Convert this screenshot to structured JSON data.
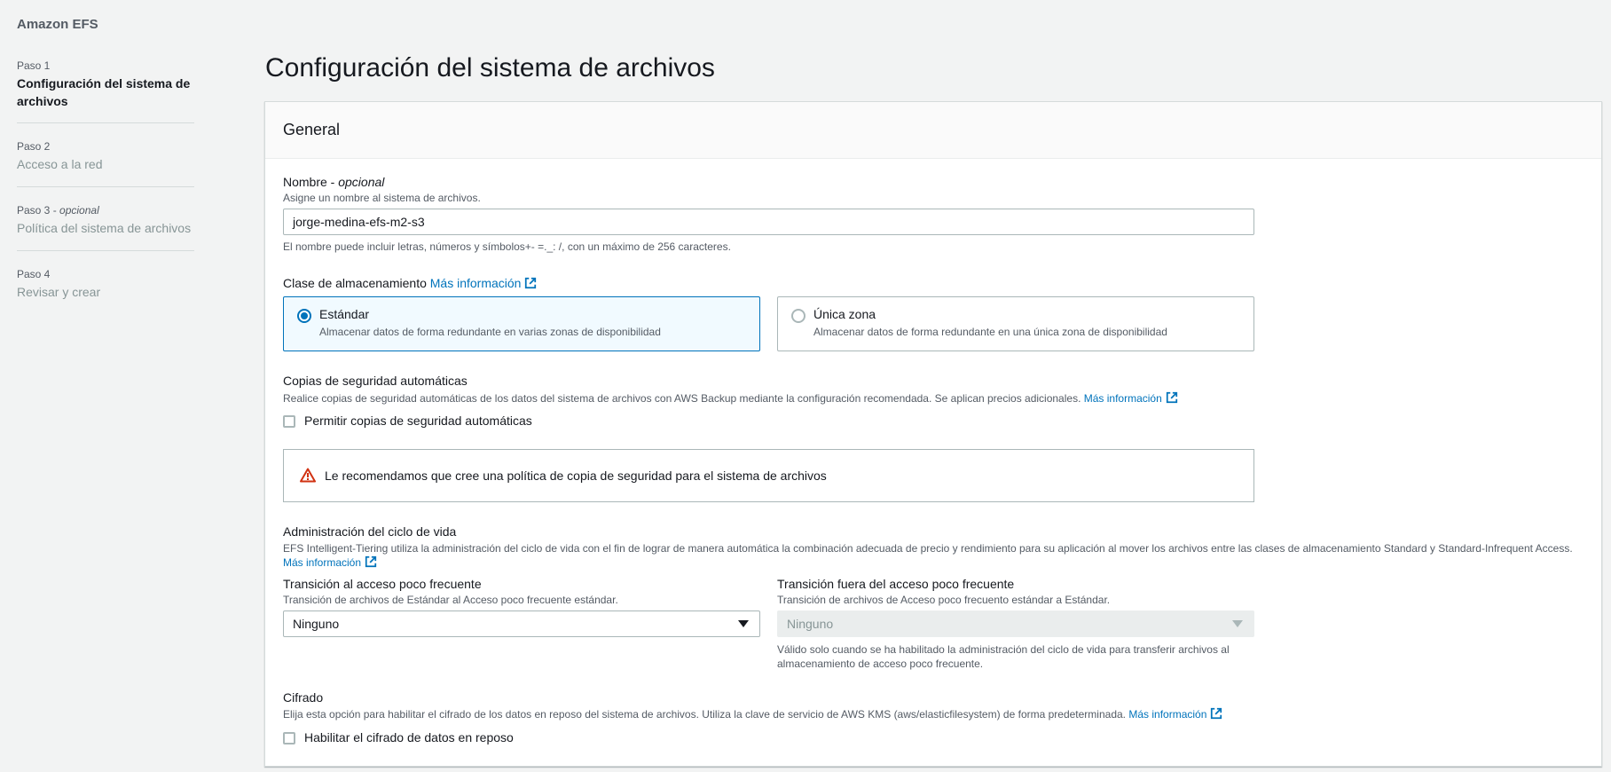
{
  "app": {
    "service_name": "Amazon EFS"
  },
  "steps": [
    {
      "num": "Paso 1",
      "optional": "",
      "title": "Configuración del sistema de archivos",
      "active": true
    },
    {
      "num": "Paso 2",
      "optional": "",
      "title": "Acceso a la red",
      "active": false
    },
    {
      "num": "Paso 3",
      "optional": "opcional",
      "title": "Política del sistema de archivos",
      "active": false
    },
    {
      "num": "Paso 4",
      "optional": "",
      "title": "Revisar y crear",
      "active": false
    }
  ],
  "page": {
    "title": "Configuración del sistema de archivos"
  },
  "panel": {
    "header": "General"
  },
  "name_field": {
    "label": "Nombre - ",
    "optional": "opcional",
    "description": "Asigne un nombre al sistema de archivos.",
    "value": "jorge-medina-efs-m2-s3",
    "constraint": "El nombre puede incluir letras, números y símbolos+- =._: /, con un máximo de 256 caracteres."
  },
  "storage_class": {
    "label": "Clase de almacenamiento",
    "info_link": "Más información",
    "options": [
      {
        "label": "Estándar",
        "description": "Almacenar datos de forma redundante en varias zonas de disponibilidad",
        "selected": true
      },
      {
        "label": "Única zona",
        "description": "Almacenar datos de forma redundante en una única zona de disponibilidad",
        "selected": false
      }
    ]
  },
  "backups": {
    "label": "Copias de seguridad automáticas",
    "description": "Realice copias de seguridad automáticas de los datos del sistema de archivos con AWS Backup mediante la configuración recomendada. Se aplican precios adicionales.",
    "info_link": "Más información",
    "checkbox_label": "Permitir copias de seguridad automáticas",
    "checked": false,
    "warning": "Le recomendamos que cree una política de copia de seguridad para el sistema de archivos"
  },
  "lifecycle": {
    "label": "Administración del ciclo de vida",
    "description": "EFS Intelligent-Tiering utiliza la administración del ciclo de vida con el fin de lograr de manera automática la combinación adecuada de precio y rendimiento para su aplicación al mover los archivos entre las clases de almacenamiento Standard y Standard-Infrequent Access.",
    "info_link": "Más información",
    "to_ia": {
      "label": "Transición al acceso poco frecuente",
      "description": "Transición de archivos de Estándar al Acceso poco frecuente estándar.",
      "value": "Ninguno"
    },
    "from_ia": {
      "label": "Transición fuera del acceso poco frecuente",
      "description": "Transición de archivos de Acceso poco frecuento estándar a Estándar.",
      "value": "Ninguno",
      "constraint": "Válido solo cuando se ha habilitado la administración del ciclo de vida para transferir archivos al almacenamiento de acceso poco frecuente."
    }
  },
  "encryption": {
    "label": "Cifrado",
    "description": "Elija esta opción para habilitar el cifrado de los datos en reposo del sistema de archivos. Utiliza la clave de servicio de AWS KMS (aws/elasticfilesystem) de forma predeterminada.",
    "info_link": "Más información",
    "checkbox_label": "Habilitar el cifrado de datos en reposo",
    "checked": false
  },
  "colors": {
    "link": "#0073bb",
    "selected_tile_bg": "#f1faff",
    "warning": "#d13212"
  }
}
